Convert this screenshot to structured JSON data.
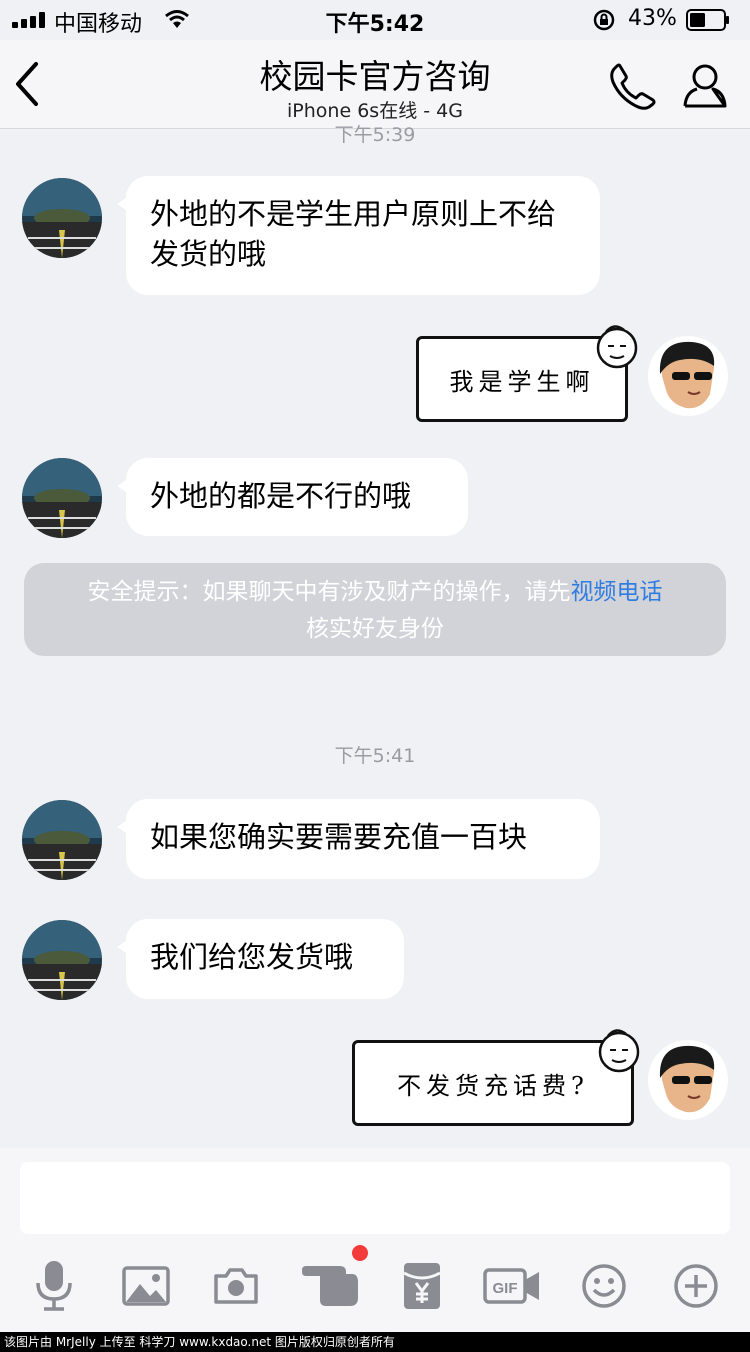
{
  "status_bar": {
    "carrier": "中国移动",
    "time": "下午5:42",
    "battery": "43%"
  },
  "header": {
    "back_icon": "chevron-left-icon",
    "title": "校园卡官方咨询",
    "subtitle": "iPhone 6s在线 - 4G",
    "call_icon": "phone-icon",
    "profile_icon": "person-icon"
  },
  "chat": {
    "timestamp_top": "下午5:39",
    "messages": [
      {
        "side": "left",
        "text": "外地的不是学生用户原则上不给发货的哦"
      },
      {
        "side": "right",
        "sticker_text": "我是学生啊"
      },
      {
        "side": "left",
        "text": "外地的都是不行的哦"
      },
      {
        "side": "left",
        "text": "如果您确实要需要充值一百块"
      },
      {
        "side": "left",
        "text": "我们给您发货哦"
      },
      {
        "side": "right",
        "sticker_text": "不发货充话费?"
      }
    ],
    "notice": {
      "prefix": "安全提示：如果聊天中有涉及财产的操作，请先",
      "link": "视频电话",
      "suffix": "核实好友身份"
    },
    "timestamp_mid": "下午5:41"
  },
  "input": {
    "value": "",
    "placeholder": ""
  },
  "toolbar": {
    "icons": [
      "microphone-icon",
      "image-icon",
      "camera-icon",
      "poke-icon",
      "red-packet-icon",
      "gif-icon",
      "emoji-icon",
      "plus-icon"
    ]
  },
  "footer": {
    "text": "该图片由 MrJelly 上传至 科学刀 www.kxdao.net 图片版权归原创者所有"
  },
  "colors": {
    "background": "#f0f1f5",
    "link": "#2f7de0",
    "badge": "#f33b3b",
    "icon": "#8a8b93"
  }
}
